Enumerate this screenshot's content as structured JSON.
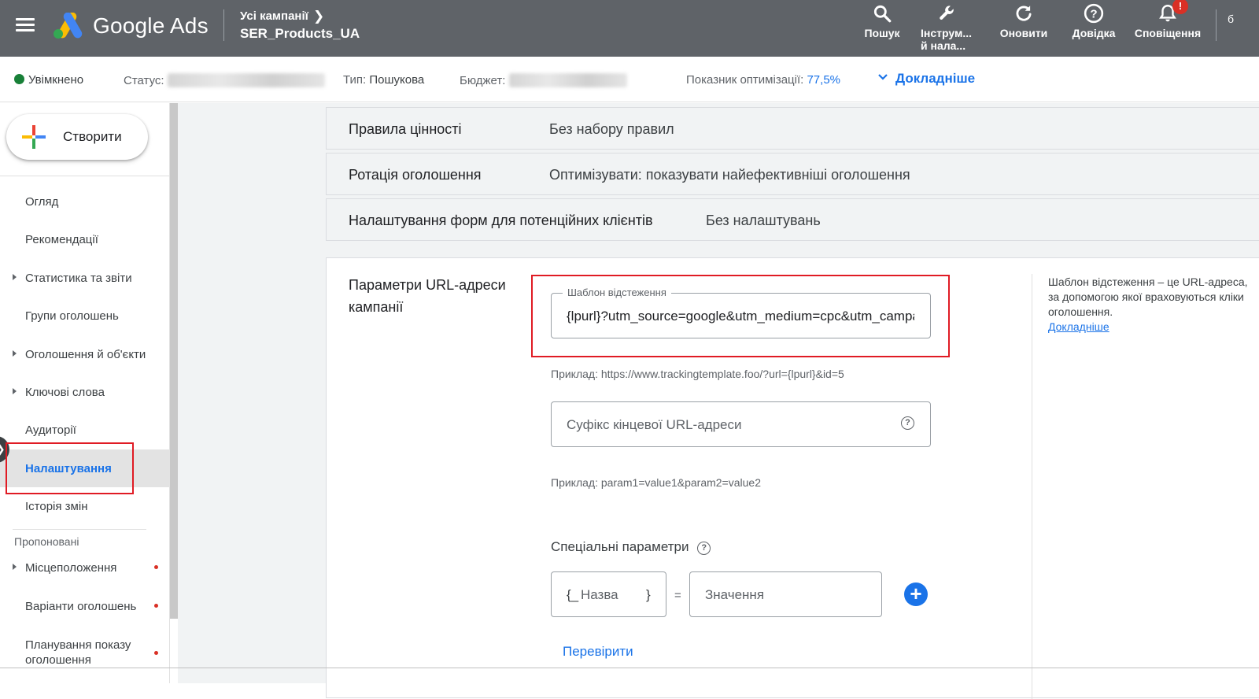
{
  "app": {
    "name": "Google Ads",
    "breadcrumb_parent": "Усі кампанії",
    "campaign_name": "SER_Products_UA"
  },
  "toolbar": {
    "search_label": "Пошук",
    "tools_label_line1": "Інструм...",
    "tools_label_line2": "й нала...",
    "refresh_label": "Оновити",
    "help_label": "Довідка",
    "notifications_label": "Сповіщення",
    "notifications_badge": "!",
    "edge_char": "б"
  },
  "statusbar": {
    "enabled": "Увімкнено",
    "status_label": "Статус:",
    "type_label": "Тип:",
    "type_value": "Пошукова",
    "budget_label": "Бюджет:",
    "optimization_label": "Показник оптимізації:",
    "optimization_value": "77,5%",
    "more_link": "Докладніше"
  },
  "sidebar": {
    "create_label": "Створити",
    "items": [
      {
        "label": "Огляд"
      },
      {
        "label": "Рекомендації"
      },
      {
        "label": "Статистика та звіти"
      },
      {
        "label": "Групи оголошень"
      },
      {
        "label": "Оголошення й об'єкти"
      },
      {
        "label": "Ключові слова"
      },
      {
        "label": "Аудиторії"
      },
      {
        "label": "Налаштування"
      },
      {
        "label": "Історія змін"
      }
    ],
    "suggested_heading": "Пропоновані",
    "suggested": [
      {
        "label": "Місцеположення"
      },
      {
        "label": "Варіанти оголошень"
      },
      {
        "label": "Планування показу",
        "label2": "оголошення"
      }
    ]
  },
  "settings_rows": [
    {
      "key": "Правила цінності",
      "value": "Без набору правил"
    },
    {
      "key": "Ротація оголошення",
      "value": "Оптимізувати: показувати найефективніші оголошення"
    },
    {
      "key": "Налаштування форм для потенційних клієнтів",
      "value": "Без налаштувань"
    }
  ],
  "url_params": {
    "title_line1": "Параметри URL-адреси",
    "title_line2": "кампанії",
    "tracking_label": "Шаблон відстеження",
    "tracking_value": "{lpurl}?utm_source=google&utm_medium=cpc&utm_campaign",
    "tracking_example": "Приклад: https://www.trackingtemplate.foo/?url={lpurl}&id=5",
    "suffix_placeholder": "Суфікс кінцевої URL-адреси",
    "suffix_example": "Приклад: param1=value1&param2=value2",
    "custom_params_label": "Спеціальні параметри",
    "name_prefix": "{_",
    "name_placeholder": "Назва",
    "name_suffix": "}",
    "equals": "=",
    "value_placeholder": "Значення",
    "add_symbol": "+",
    "check_link": "Перевірити",
    "help_text": "Шаблон відстеження – це URL-адреса, за допомогою якої враховуються кліки оголошення.",
    "help_link": "Докладніше"
  }
}
